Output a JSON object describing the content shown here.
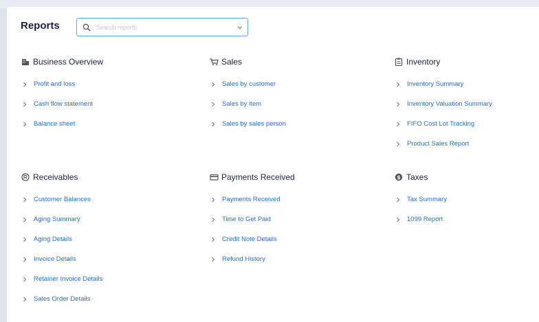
{
  "page": {
    "title": "Reports",
    "search": {
      "placeholder": "Search reports",
      "value": ""
    }
  },
  "sections": [
    {
      "key": "business",
      "title": "Business Overview",
      "icon": "building-icon",
      "items": [
        "Profit and loss",
        "Cash flow statement",
        "Balance sheet"
      ]
    },
    {
      "key": "sales",
      "title": "Sales",
      "icon": "cart-icon",
      "items": [
        "Sales by customer",
        "Sales by item",
        "Sales by sales person"
      ]
    },
    {
      "key": "inventory",
      "title": "Inventory",
      "icon": "clipboard-icon",
      "items": [
        "Inventory Summary",
        "Inventory Valuation Summary",
        "FIFO Cost Lot Tracking",
        "Product Sales Report"
      ]
    },
    {
      "key": "receivables",
      "title": "Receivables",
      "icon": "receivable-coin-icon",
      "items": [
        "Customer Balances",
        "Aging Summary",
        "Aging Details",
        "Invoice Details",
        "Retainer Invoice Details",
        "Sales Order Details"
      ]
    },
    {
      "key": "payments",
      "title": "Payments Received",
      "icon": "credit-card-icon",
      "items": [
        "Payments Received",
        "Time to Get Paid",
        "Credit Note Details",
        "Refund History"
      ]
    },
    {
      "key": "taxes",
      "title": "Taxes",
      "icon": "dollar-coin-icon",
      "items": [
        "Tax Summary",
        "1099 Report"
      ]
    }
  ],
  "colors": {
    "link": "#2a6fc9",
    "heading": "#1f2240",
    "search_border": "#6aa3e6"
  }
}
